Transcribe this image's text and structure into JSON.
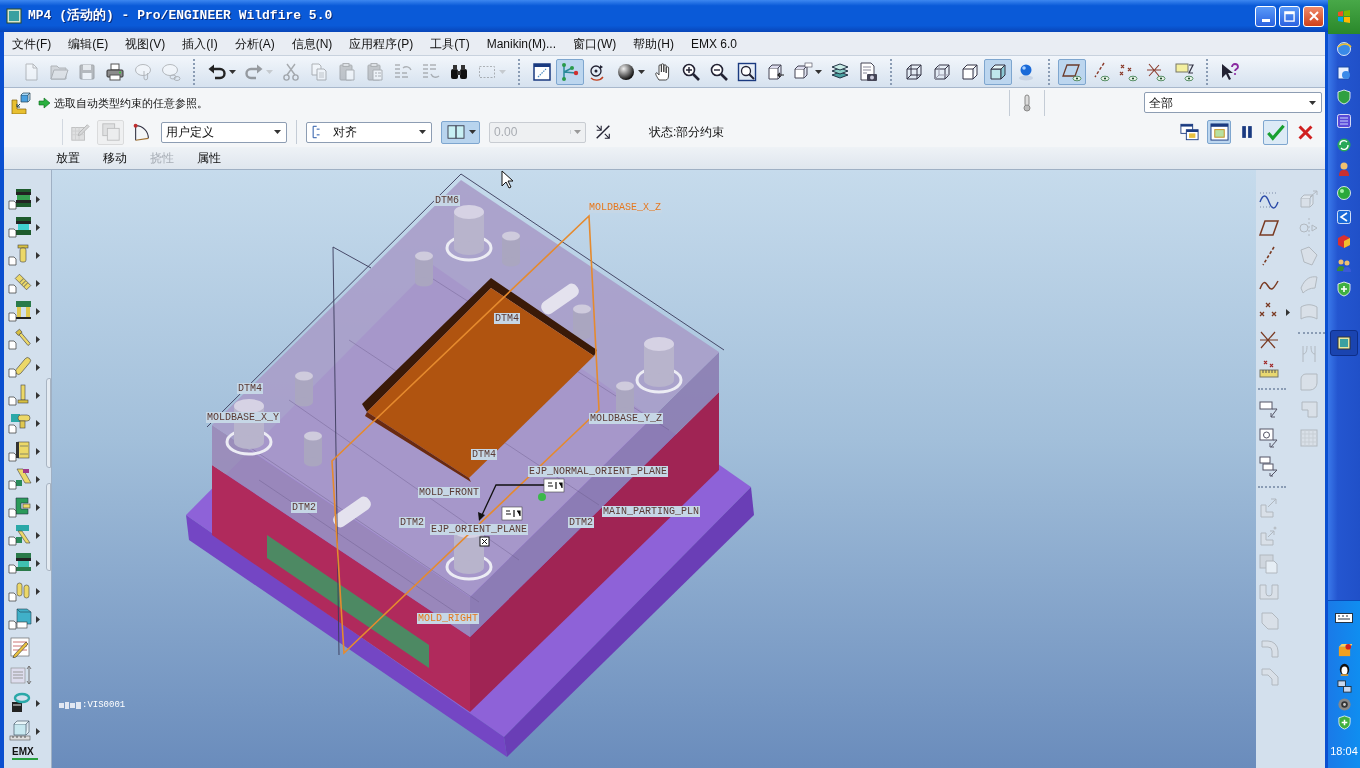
{
  "window": {
    "title": "MP4 (活动的) - Pro/ENGINEER Wildfire 5.0"
  },
  "menu": [
    "文件(F)",
    "编辑(E)",
    "视图(V)",
    "插入(I)",
    "分析(A)",
    "信息(N)",
    "应用程序(P)",
    "工具(T)",
    "Manikin(M)...",
    "窗口(W)",
    "帮助(H)",
    "EMX 6.0"
  ],
  "toolbar": {
    "groups": [
      [
        {
          "pressed": false,
          "disabled": true
        },
        {
          "pressed": false,
          "disabled": true
        },
        {
          "pressed": false,
          "disabled": true
        },
        {
          "pressed": false,
          "disabled": false
        },
        {
          "pressed": false,
          "disabled": true
        },
        {
          "pressed": false,
          "disabled": true
        }
      ],
      [
        {
          "pressed": false,
          "disabled": false
        },
        {
          "pressed": false,
          "disabled": true
        },
        {
          "pressed": false,
          "disabled": true
        },
        {
          "pressed": false,
          "disabled": true
        },
        {
          "pressed": false,
          "disabled": true
        },
        {
          "pressed": false,
          "disabled": true
        },
        {
          "pressed": false,
          "disabled": true
        },
        {
          "pressed": false,
          "disabled": true
        },
        {
          "pressed": false,
          "disabled": false
        },
        {
          "pressed": false,
          "disabled": true
        }
      ],
      [
        {
          "pressed": false,
          "disabled": false
        },
        {
          "pressed": true,
          "disabled": false
        },
        {
          "pressed": false,
          "disabled": false
        },
        {
          "pressed": false,
          "disabled": false
        },
        {
          "pressed": false,
          "disabled": false
        },
        {
          "pressed": false,
          "disabled": false
        },
        {
          "pressed": false,
          "disabled": false
        },
        {
          "pressed": false,
          "disabled": false
        },
        {
          "pressed": false,
          "disabled": false
        },
        {
          "pressed": false,
          "disabled": false
        },
        {
          "pressed": false,
          "disabled": false
        },
        {
          "pressed": false,
          "disabled": false
        }
      ],
      [
        {
          "pressed": false,
          "disabled": false
        },
        {
          "pressed": false,
          "disabled": false
        },
        {
          "pressed": false,
          "disabled": false
        },
        {
          "pressed": true,
          "disabled": false
        },
        {
          "pressed": false,
          "disabled": false
        }
      ],
      [
        {
          "pressed": true,
          "disabled": false
        },
        {
          "pressed": false,
          "disabled": false
        },
        {
          "pressed": false,
          "disabled": false
        },
        {
          "pressed": false,
          "disabled": false
        },
        {
          "pressed": false,
          "disabled": false
        }
      ],
      [
        {
          "pressed": false,
          "disabled": false
        }
      ]
    ]
  },
  "message": {
    "text": "选取自动类型约束的任意参照。"
  },
  "filter": {
    "value": "全部"
  },
  "dashboard": {
    "tools": [
      {
        "disabled": true
      },
      {
        "disabled": true
      },
      {
        "disabled": false
      }
    ],
    "set_type": {
      "value": "用户定义"
    },
    "constraint": {
      "value": "对齐"
    },
    "offset_type": {
      "pressed": true
    },
    "offset": {
      "value": "0.00",
      "disabled": true
    },
    "status": "状态:部分约束",
    "toggles": [
      {
        "pressed": false
      },
      {
        "pressed": true
      }
    ],
    "tabs": [
      {
        "label": "放置",
        "disabled": false
      },
      {
        "label": "移动",
        "disabled": false
      },
      {
        "label": "挠性",
        "disabled": true
      },
      {
        "label": "属性",
        "disabled": false
      }
    ]
  },
  "left_toolbar": {
    "footer": "EMX"
  },
  "graphics": {
    "labels": [
      {
        "text": "DTM6",
        "highlighted": false
      },
      {
        "text": "MOLDBASE_X_Z",
        "highlighted": true
      },
      {
        "text": "DTM4",
        "highlighted": false
      },
      {
        "text": "DTM4",
        "highlighted": false
      },
      {
        "text": "MOLDBASE_X_Y",
        "highlighted": false
      },
      {
        "text": "MOLDBASE_Y_Z",
        "highlighted": false
      },
      {
        "text": "DTM4",
        "highlighted": false
      },
      {
        "text": "EJP_NORMAL_ORIENT_PLANE",
        "highlighted": false
      },
      {
        "text": "MOLD_FRONT",
        "highlighted": false
      },
      {
        "text": "DTM2",
        "highlighted": false
      },
      {
        "text": "DTM2",
        "highlighted": false
      },
      {
        "text": "EJP_ORIENT_PLANE",
        "highlighted": false
      },
      {
        "text": "DTM2",
        "highlighted": false
      },
      {
        "text": "MAIN_PARTING_PLN",
        "highlighted": false
      },
      {
        "text": "MOLD_RIGHT",
        "highlighted": true
      }
    ],
    "model_note": ":VIS0001"
  },
  "right_toolbar": {
    "columns": [
      [
        [
          {
            "disabled": false
          },
          {
            "disabled": false
          },
          {
            "disabled": false
          },
          {
            "disabled": false
          },
          {
            "disabled": false
          },
          {
            "disabled": false
          },
          {
            "disabled": false
          }
        ],
        [
          {
            "disabled": false
          },
          {
            "disabled": false
          },
          {
            "disabled": false
          }
        ],
        [
          {
            "disabled": true
          },
          {
            "disabled": true
          },
          {
            "disabled": true
          },
          {
            "disabled": true
          },
          {
            "disabled": true
          },
          {
            "disabled": true
          },
          {
            "disabled": true
          }
        ]
      ],
      [
        [
          {
            "disabled": true
          },
          {
            "disabled": true
          },
          {
            "disabled": true
          },
          {
            "disabled": true
          },
          {
            "disabled": true
          }
        ],
        [
          {
            "disabled": true
          },
          {
            "disabled": true
          },
          {
            "disabled": true
          },
          {
            "disabled": true
          }
        ]
      ]
    ]
  },
  "taskbar": {
    "clock": "18:04"
  }
}
